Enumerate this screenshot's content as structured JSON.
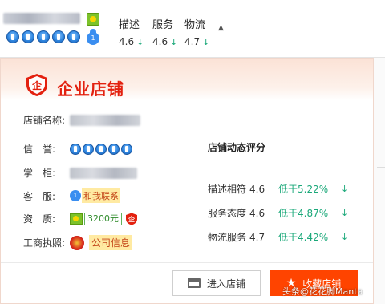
{
  "topbar": {
    "scores": [
      {
        "label": "描述",
        "value": "4.6",
        "arrow": "↓"
      },
      {
        "label": "服务",
        "value": "4.6",
        "arrow": "↓"
      },
      {
        "label": "物流",
        "value": "4.7",
        "arrow": "↓"
      }
    ],
    "caret": "▲",
    "vip_badge": "1"
  },
  "card": {
    "title": "企业店铺",
    "shield_glyph": "企",
    "rows": {
      "name_label": "店铺名称:",
      "credit_label": "信　誉:",
      "owner_label": "掌　柜:",
      "service_label": "客　服:",
      "service_badge": "1",
      "contact_link": "和我联系",
      "qual_label": "资　质:",
      "deposit": "3200元",
      "biz_label": "工商执照:",
      "company_info": "公司信息"
    },
    "dsr": {
      "title": "店铺动态评分",
      "items": [
        {
          "label": "描述相符",
          "score": "4.6",
          "compare": "低于5.22%",
          "arrow": "↓"
        },
        {
          "label": "服务态度",
          "score": "4.6",
          "compare": "低于4.87%",
          "arrow": "↓"
        },
        {
          "label": "物流服务",
          "score": "4.7",
          "compare": "低于4.42%",
          "arrow": "↓"
        }
      ]
    },
    "buttons": {
      "enter_store": "进入店铺",
      "favorite_store": "收藏店铺",
      "star": "★"
    }
  },
  "watermark": "头条@花花脚Manta",
  "colors": {
    "brand_red": "#e3210f",
    "fav_orange": "#ff4400",
    "down_green": "#1aa879"
  }
}
